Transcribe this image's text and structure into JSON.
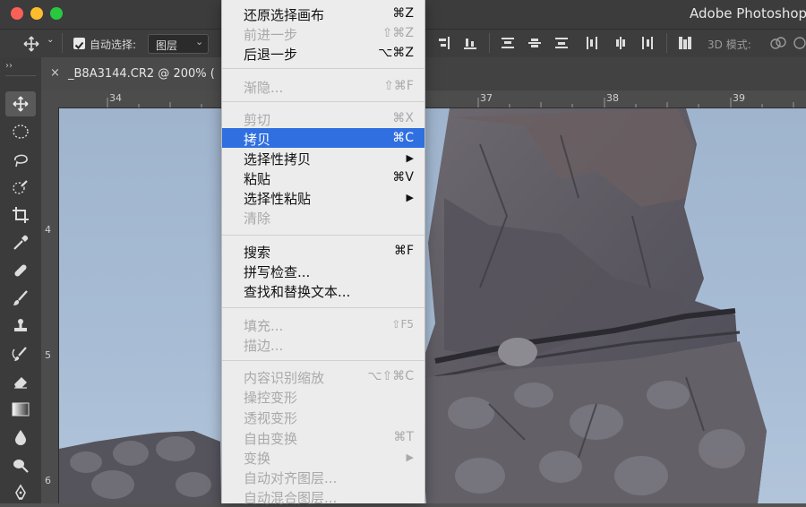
{
  "window": {
    "app_title": "Adobe Photoshop CC",
    "traffic_lights": {
      "close": "#fc5f57",
      "minimize": "#fdbc2e",
      "zoom": "#28c840"
    }
  },
  "options_bar": {
    "auto_select_label": "自动选择:",
    "auto_select_value": "图层",
    "mode_3d_label": "3D 模式:"
  },
  "document_tab": {
    "title": "_B8A3144.CR2 @ 200% ("
  },
  "rulers": {
    "horizontal": [
      "34",
      "37",
      "38",
      "39"
    ],
    "vertical": [
      "4",
      "5",
      "6"
    ]
  },
  "tools": [
    {
      "name": "move-tool",
      "icon": "move-icon"
    },
    {
      "name": "marquee-tool",
      "icon": "ellipse-marquee-icon"
    },
    {
      "name": "lasso-tool",
      "icon": "lasso-icon"
    },
    {
      "name": "quick-select-tool",
      "icon": "quick-select-icon"
    },
    {
      "name": "crop-tool",
      "icon": "crop-icon"
    },
    {
      "name": "eyedropper-tool",
      "icon": "eyedropper-icon"
    },
    {
      "name": "healing-tool",
      "icon": "bandage-icon"
    },
    {
      "name": "brush-tool",
      "icon": "brush-icon"
    },
    {
      "name": "stamp-tool",
      "icon": "stamp-icon"
    },
    {
      "name": "history-brush-tool",
      "icon": "history-brush-icon"
    },
    {
      "name": "eraser-tool",
      "icon": "eraser-icon"
    },
    {
      "name": "gradient-tool",
      "icon": "gradient-icon"
    },
    {
      "name": "blur-tool",
      "icon": "drop-icon"
    },
    {
      "name": "dodge-tool",
      "icon": "dodge-icon"
    },
    {
      "name": "pen-tool",
      "icon": "pen-icon"
    }
  ],
  "menu": {
    "items": [
      {
        "label": "还原选择画布",
        "shortcut": "⌘Z",
        "enabled": true
      },
      {
        "label": "前进一步",
        "shortcut": "⇧⌘Z",
        "enabled": false
      },
      {
        "label": "后退一步",
        "shortcut": "⌥⌘Z",
        "enabled": true
      },
      {
        "label": "渐隐...",
        "shortcut": "⇧⌘F",
        "enabled": false
      },
      {
        "label": "剪切",
        "shortcut": "⌘X",
        "enabled": false
      },
      {
        "label": "拷贝",
        "shortcut": "⌘C",
        "enabled": true,
        "highlighted": true
      },
      {
        "label": "选择性拷贝",
        "shortcut": "▶",
        "enabled": true
      },
      {
        "label": "粘贴",
        "shortcut": "⌘V",
        "enabled": true
      },
      {
        "label": "选择性粘贴",
        "shortcut": "▶",
        "enabled": true
      },
      {
        "label": "清除",
        "shortcut": "",
        "enabled": false
      },
      {
        "label": "搜索",
        "shortcut": "⌘F",
        "enabled": true
      },
      {
        "label": "拼写检查...",
        "shortcut": "",
        "enabled": true
      },
      {
        "label": "查找和替换文本...",
        "shortcut": "",
        "enabled": true
      },
      {
        "label": "填充...",
        "shortcut": "⇧F5",
        "enabled": false
      },
      {
        "label": "描边...",
        "shortcut": "",
        "enabled": false
      },
      {
        "label": "内容识别缩放",
        "shortcut": "⌥⇧⌘C",
        "enabled": false
      },
      {
        "label": "操控变形",
        "shortcut": "",
        "enabled": false
      },
      {
        "label": "透视变形",
        "shortcut": "",
        "enabled": false
      },
      {
        "label": "自由变换",
        "shortcut": "⌘T",
        "enabled": false
      },
      {
        "label": "变换",
        "shortcut": "▶",
        "enabled": false
      },
      {
        "label": "自动对齐图层...",
        "shortcut": "",
        "enabled": false
      },
      {
        "label": "自动混合图层...",
        "shortcut": "",
        "enabled": false
      }
    ]
  },
  "colors": {
    "menu_highlight": "#2f6fe0",
    "menu_bg": "#ececec",
    "ps_dark": "#3b3b3b"
  }
}
